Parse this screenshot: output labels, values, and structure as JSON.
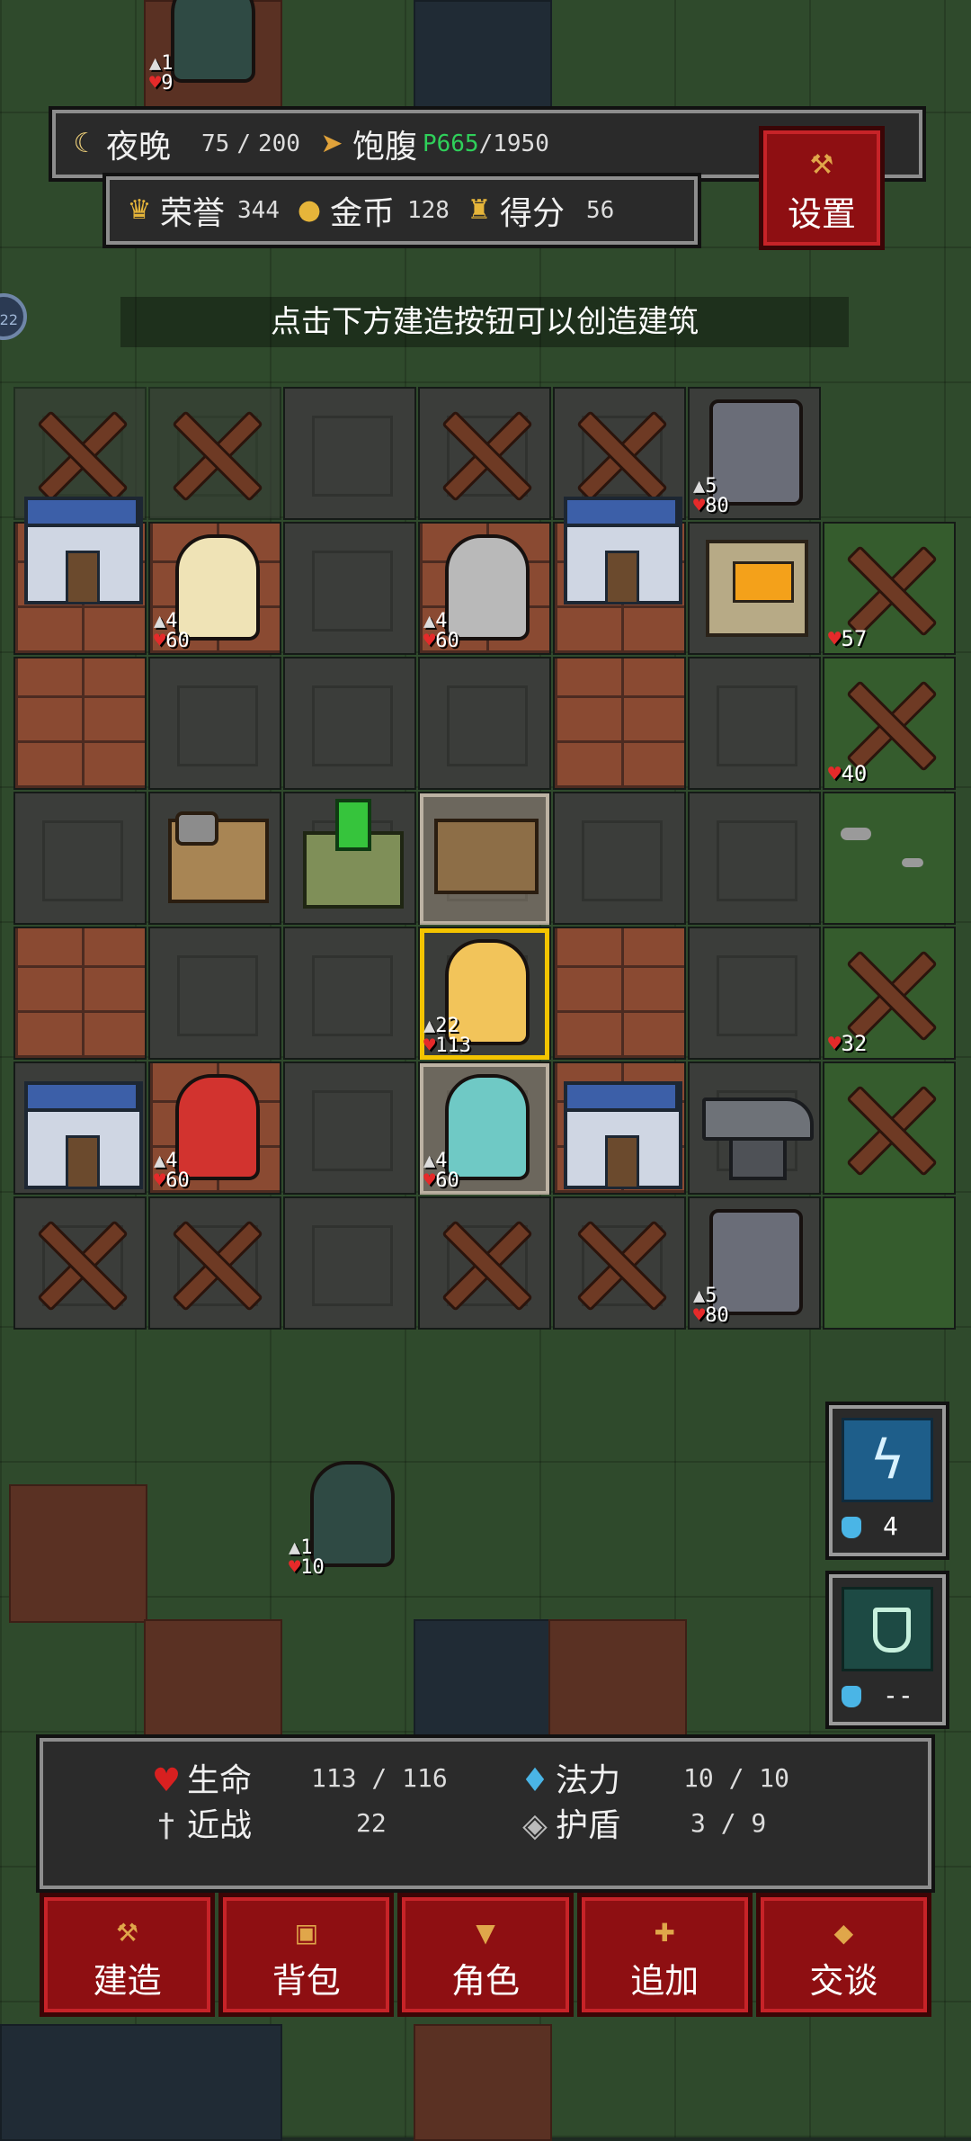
{
  "hud": {
    "time_label": "夜晚",
    "time_current": "75",
    "time_max": "200",
    "food_label": "饱腹",
    "food_current": "P665",
    "food_max": "1950",
    "honor_label": "荣誉",
    "honor_value": "344",
    "gold_label": "金币",
    "gold_value": "128",
    "score_label": "得分",
    "score_value": "56",
    "settings_label": "设置"
  },
  "hint": "点击下方建造按钮可以创造建筑",
  "edge_badge": "22",
  "board_units": {
    "top_enemy": {
      "atk": "1",
      "hp": "9"
    },
    "angel": {
      "atk": "4",
      "hp": "60"
    },
    "dwarf": {
      "atk": "4",
      "hp": "60"
    },
    "tower_top": {
      "atk": "5",
      "hp": "80"
    },
    "spike_57": {
      "hp": "57"
    },
    "spike_40": {
      "hp": "40"
    },
    "hero": {
      "atk": "22",
      "hp": "113"
    },
    "spike_32": {
      "hp": "32"
    },
    "red_hood": {
      "atk": "4",
      "hp": "60"
    },
    "mage": {
      "atk": "4",
      "hp": "60"
    },
    "tower_bottom": {
      "atk": "5",
      "hp": "80"
    },
    "bottom_enemy": {
      "atk": "1",
      "hp": "10"
    }
  },
  "skills": [
    {
      "icon": "lightning-scroll-icon",
      "cost": "4"
    },
    {
      "icon": "shield-scroll-icon",
      "cost": "--"
    }
  ],
  "status": {
    "hp_label": "生命",
    "hp_value": "113 / 116",
    "mp_label": "法力",
    "mp_value": "10 / 10",
    "melee_label": "近战",
    "melee_value": "22",
    "shield_label": "护盾",
    "shield_value": "3 / 9"
  },
  "buttons": {
    "build": "建造",
    "bag": "背包",
    "character": "角色",
    "add": "追加",
    "talk": "交谈"
  },
  "colors": {
    "button_red": "#8e0f12",
    "highlight_yellow": "#f4c400",
    "hp_red": "#e52a2a",
    "mana_blue": "#4ab5e6"
  }
}
